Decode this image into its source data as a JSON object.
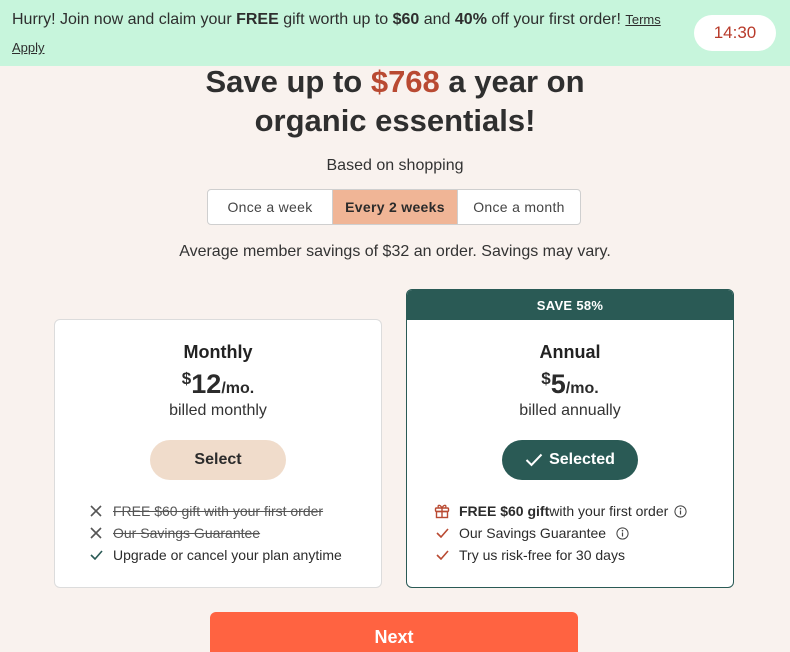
{
  "promo": {
    "part1": "Hurry! Join now and claim your ",
    "free": "FREE",
    "part2": " gift worth up to ",
    "gift_value": "$60",
    "part3": " and ",
    "discount": "40%",
    "part4": " off your first order! ",
    "terms": "Terms Apply",
    "timer": "14:30"
  },
  "headline": {
    "pre": "Save up to ",
    "amount": "$768",
    "post_line1": " a year on",
    "line2": "organic essentials!"
  },
  "frequency": {
    "label": "Based on shopping",
    "options": [
      "Once a week",
      "Every 2 weeks",
      "Once a month"
    ],
    "selected": "Every 2 weeks"
  },
  "average_note": "Average member savings of $32 an order. Savings may vary.",
  "plans": {
    "monthly": {
      "name": "Monthly",
      "currency": "$",
      "price": "12",
      "per": "/mo.",
      "billed": "billed monthly",
      "button": "Select",
      "features": [
        "FREE $60 gift with your first order",
        "Our Savings Guarantee",
        "Upgrade or cancel your plan anytime"
      ]
    },
    "annual": {
      "badge": "SAVE 58%",
      "name": "Annual",
      "currency": "$",
      "price": "5",
      "per": "/mo.",
      "billed": "billed annually",
      "button": "Selected",
      "feature1_bold": "FREE $60 gift",
      "feature1_rest": " with your first order",
      "feature2": "Our Savings Guarantee",
      "feature3": "Try us risk-free for 30 days"
    }
  },
  "next_label": "Next",
  "colors": {
    "background": "#f9f2ee",
    "promo_bg": "#c7f5dc",
    "accent_red": "#b94a32",
    "teal": "#2a5a55",
    "tab_active": "#f0b596",
    "next_button": "#ff6341"
  }
}
